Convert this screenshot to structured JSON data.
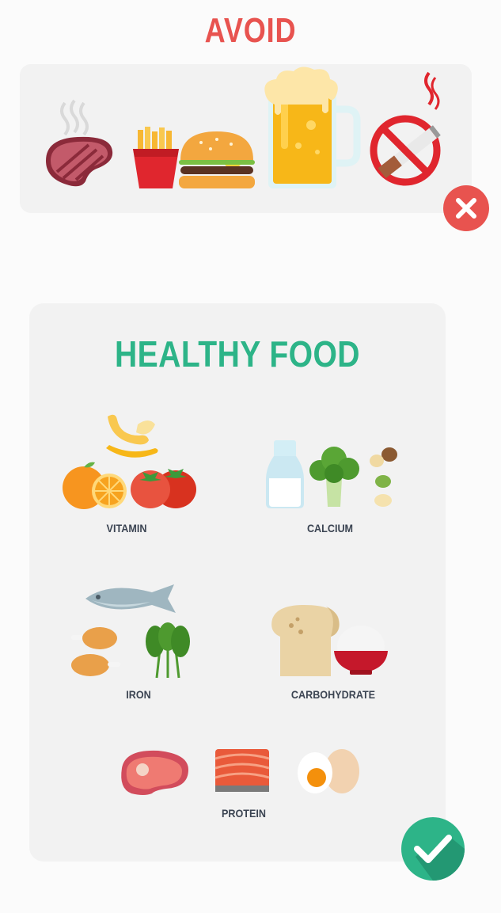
{
  "avoid": {
    "title": "AVOID",
    "items": [
      "steak-icon",
      "fries-icon",
      "burger-icon",
      "beer-icon",
      "no-smoking-icon"
    ],
    "badge": "x-icon",
    "accent": "#e8534f"
  },
  "healthy": {
    "title": "HEALTHY FOOD",
    "accent": "#2db488",
    "categories": [
      {
        "label": "VITAMIN",
        "icons": [
          "banana-icon",
          "orange-icon",
          "tomato-icon"
        ]
      },
      {
        "label": "CALCIUM",
        "icons": [
          "milk-bottle-icon",
          "broccoli-icon",
          "nuts-icon"
        ]
      },
      {
        "label": "IRON",
        "icons": [
          "fish-icon",
          "chicken-leg-icon",
          "spinach-icon"
        ]
      },
      {
        "label": "CARBOHYDRATE",
        "icons": [
          "bread-icon",
          "rice-bowl-icon"
        ]
      },
      {
        "label": "PROTEIN",
        "icons": [
          "meat-icon",
          "salmon-icon",
          "egg-icon"
        ]
      }
    ],
    "badge": "check-icon"
  }
}
